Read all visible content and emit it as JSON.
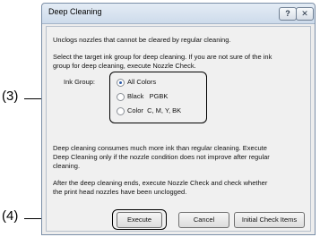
{
  "callouts": {
    "three": "(3)",
    "four": "(4)"
  },
  "dialog": {
    "title": "Deep Cleaning",
    "help_symbol": "?",
    "close_symbol": "✕",
    "intro": "Unclogs nozzles that cannot be cleared by regular cleaning.",
    "instructions_line1": "Select the target ink group for deep cleaning. If you are not sure of the ink",
    "instructions_line2": "group for deep cleaning, execute Nozzle Check.",
    "ink_group_label": "Ink Group:",
    "ink_options": [
      "All Colors",
      "Black   PGBK",
      "Color  C, M, Y, BK"
    ],
    "selected_option": "All Colors",
    "warning_line1": "Deep cleaning consumes much more ink than regular cleaning. Execute",
    "warning_line2": "Deep Cleaning only if the nozzle condition does not improve after regular",
    "warning_line3": "cleaning.",
    "after_line1": "After the deep cleaning ends, execute Nozzle Check and check whether",
    "after_line2": "the print head nozzles have been unclogged.",
    "buttons": {
      "execute": "Execute",
      "cancel": "Cancel",
      "initial_check": "Initial Check Items"
    }
  }
}
